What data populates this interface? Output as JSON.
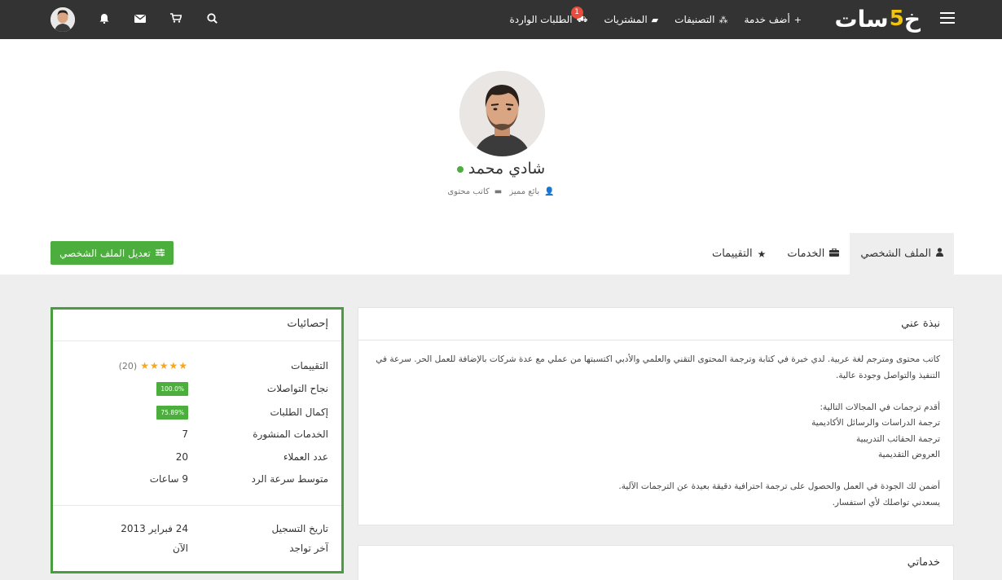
{
  "header": {
    "logo_text": "خمسات",
    "nav": [
      {
        "label": "أضف خدمة",
        "icon": "plus-icon",
        "glyph": "+"
      },
      {
        "label": "التصنيفات",
        "icon": "cubes-icon",
        "glyph": "⁂"
      },
      {
        "label": "المشتريات",
        "icon": "folder-icon",
        "glyph": "▰"
      },
      {
        "label": "الطلبات الواردة",
        "icon": "truck-icon",
        "glyph": "⛟",
        "badge": "1"
      }
    ],
    "icons": [
      "search-icon",
      "cart-icon",
      "envelope-icon",
      "bell-icon",
      "user-avatar"
    ]
  },
  "profile": {
    "name": "شادي محمد",
    "status_color": "#4cae3c",
    "meta": [
      {
        "label": "كاتب محتوى",
        "icon": "briefcase-icon"
      },
      {
        "label": "بائع مميز",
        "icon": "user-icon"
      }
    ],
    "tabs": [
      {
        "label": "الملف الشخصي",
        "icon": "user-icon",
        "glyph": "👤",
        "active": true
      },
      {
        "label": "الخدمات",
        "icon": "briefcase-icon",
        "glyph": "💼"
      },
      {
        "label": "التقييمات",
        "icon": "star-icon",
        "glyph": "★"
      }
    ],
    "edit_button": "تعديل الملف الشخصي"
  },
  "about": {
    "title": "نبذة عني",
    "paragraphs": [
      "كاتب محتوى ومترجم لغة عربية. لدي خبرة في كتابة وترجمة المحتوى التقني والعلمي والأدبي اكتسبتها من عملي مع عدة شركات بالإضافة للعمل الحر. سرعة في التنفيذ والتواصل وجودة عالية.",
      "",
      "أقدم ترجمات في المجالات التالية:",
      "ترجمة الدراسات والرسائل الأكاديمية",
      "ترجمة الحقائب التدريبية",
      "العروض التقديمية",
      "",
      "أضمن لك الجودة في العمل والحصول على ترجمة احترافية دقيقة بعيدة عن الترجمات الآلية.",
      "يسعدني تواصلك لأي استفسار."
    ]
  },
  "services_card": {
    "title": "خدماتي"
  },
  "stats": {
    "title": "إحصائيات",
    "rating": {
      "label": "التقييمات",
      "stars": 5,
      "count": "(20)"
    },
    "rows": [
      {
        "label": "نجاح التواصلات",
        "value": "100.0%",
        "type": "badge"
      },
      {
        "label": "إكمال الطلبات",
        "value": "75.89%",
        "type": "badge"
      },
      {
        "label": "الخدمات المنشورة",
        "value": "7"
      },
      {
        "label": "عدد العملاء",
        "value": "20"
      },
      {
        "label": "متوسط سرعة الرد",
        "value": "9 ساعات"
      }
    ],
    "rows2": [
      {
        "label": "تاريخ التسجيل",
        "value": "24 فبراير 2013"
      },
      {
        "label": "آخر تواجد",
        "value": "الآن"
      }
    ]
  },
  "colors": {
    "topbar": "#333333",
    "brand_accent": "#f2c40e",
    "green": "#4cae3c",
    "badge_red": "#e74c3c"
  }
}
